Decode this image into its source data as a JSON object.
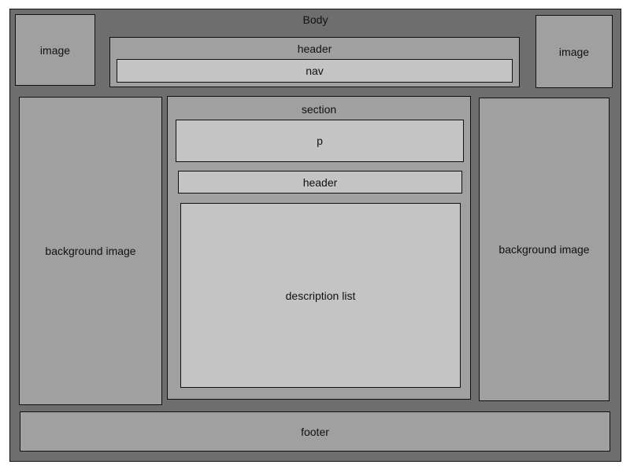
{
  "colors": {
    "dark": "#6e6e6e",
    "mid": "#a0a0a0",
    "light": "#c4c4c4",
    "border": "#111111"
  },
  "labels": {
    "body": "Body",
    "image_left": "image",
    "image_right": "image",
    "header_top": "header",
    "nav": "nav",
    "background_image_left": "background image",
    "background_image_right": "background image",
    "section": "section",
    "p": "p",
    "header_mid": "header",
    "description_list": "description list",
    "footer": "footer"
  }
}
